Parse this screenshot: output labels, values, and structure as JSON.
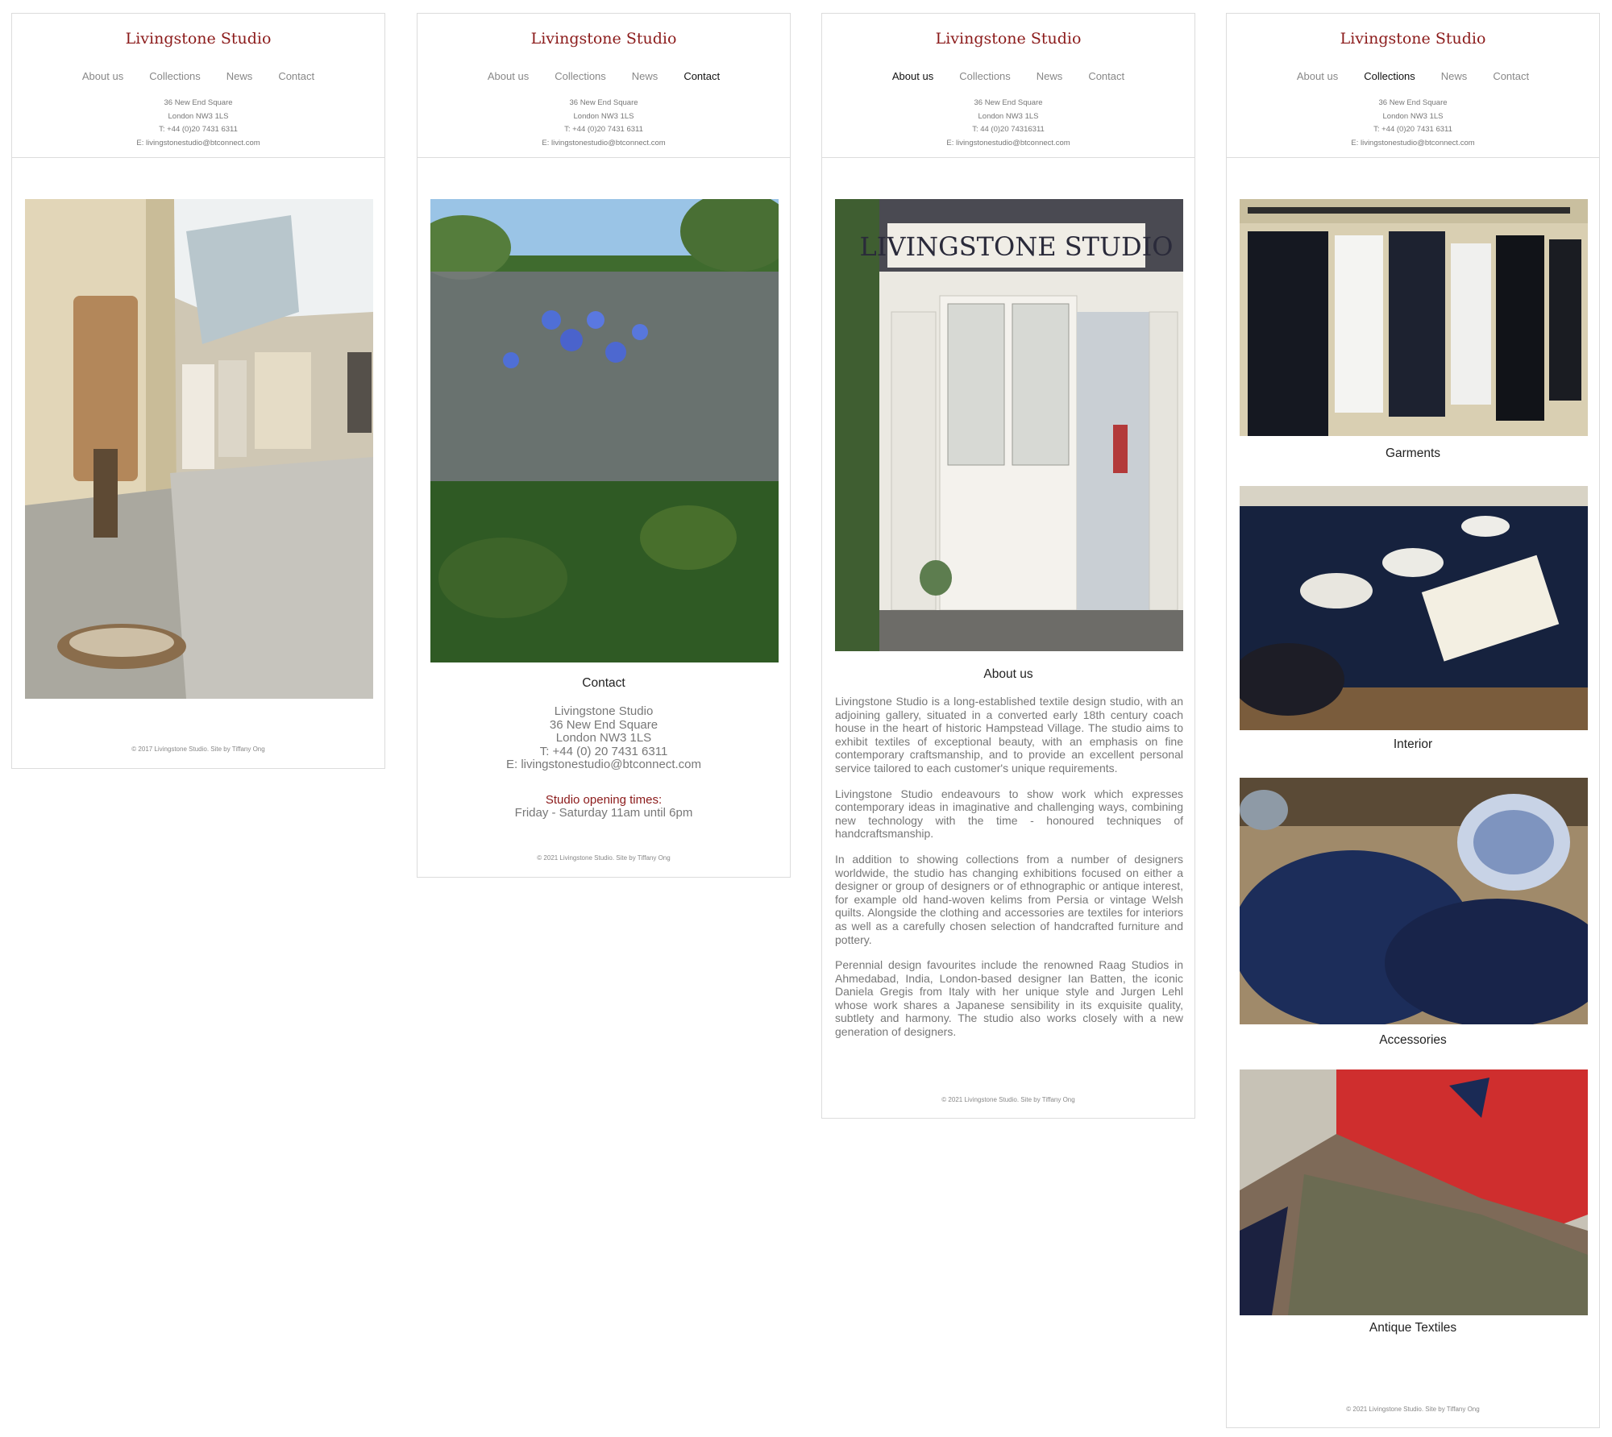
{
  "site": {
    "brand": "Livingstone Studio",
    "nav": [
      "About us",
      "Collections",
      "News",
      "Contact"
    ],
    "address_lines": [
      "36 New End Square",
      "London NW3 1LS",
      "T: +44 (0)20 7431 6311",
      "E: livingstonestudio@btconnect.com"
    ],
    "address_lines_about": [
      "36 New End Square",
      "London NW3 1LS",
      "T: 44 (0)20 74316311",
      "E: livingstonestudio@btconnect.com"
    ]
  },
  "panels": {
    "home": {
      "active_nav": "",
      "footer": "© 2017 Livingstone Studio. Site by Tiffany Ong"
    },
    "contact": {
      "active_nav": "Contact",
      "heading": "Contact",
      "lines": [
        "Livingstone Studio",
        "36 New End Square",
        "London NW3 1LS",
        "T: +44 (0) 20 7431 6311",
        "E: livingstonestudio@btconnect.com"
      ],
      "hours_title": "Studio opening times:",
      "hours": "Friday - Saturday 11am until 6pm",
      "footer": "© 2021 Livingstone Studio. Site by Tiffany Ong"
    },
    "about": {
      "active_nav": "About us",
      "sign_text": "LIVINGSTONE STUDIO",
      "heading": "About us",
      "paragraphs": [
        "Livingstone Studio is a long-established textile design studio, with an adjoining gallery, situated in a converted early 18th century coach house in the heart of historic Hampstead Village. The studio aims to exhibit textiles of exceptional beauty, with an emphasis on fine contemporary craftsmanship, and to provide an excellent personal service tailored to each customer's unique requirements.",
        "Livingstone Studio endeavours to show work which expresses contemporary ideas in imaginative and challenging ways, combining new technology with the time - honoured techniques of handcraftsmanship.",
        "In addition to showing collections from a number of designers worldwide, the studio has changing exhibitions focused on either a designer or group of designers or of ethnographic or antique interest, for example old hand-woven kelims from Persia or vintage Welsh quilts. Alongside the clothing and accessories are textiles for interiors as well as a carefully chosen selection of handcrafted furniture and pottery.",
        "Perennial design favourites include the renowned Raag Studios in Ahmedabad, India, London-based designer Ian Batten, the iconic Daniela Gregis from Italy with her unique style and Jurgen Lehl whose work shares a Japanese sensibility in its exquisite quality, subtlety and harmony. The studio also works closely with a new generation of designers."
      ],
      "footer": "© 2021 Livingstone Studio. Site by Tiffany Ong"
    },
    "collections": {
      "active_nav": "Collections",
      "items": [
        "Garments",
        "Interior",
        "Accessories",
        "Antique Textiles"
      ],
      "footer": "© 2021 Livingstone Studio. Site by Tiffany Ong"
    }
  },
  "colors": {
    "brand": "#8b1a1a",
    "nav_text": "#888888",
    "nav_active": "#111111",
    "border": "#dcdcdc"
  }
}
